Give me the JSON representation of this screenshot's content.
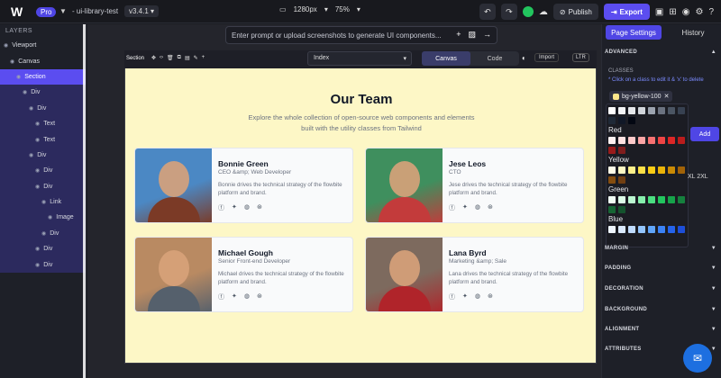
{
  "topbar": {
    "logo": "W",
    "plan_badge": "Pro",
    "project": "- ui-library-test",
    "version": "v3.4.1",
    "resolution": "1280px",
    "zoom": "75%",
    "publish_label": "Publish",
    "export_label": "Export"
  },
  "layers": {
    "title": "LAYERS",
    "items": [
      {
        "label": "Viewport",
        "indent": 0
      },
      {
        "label": "Canvas",
        "indent": 1
      },
      {
        "label": "Section",
        "indent": 2,
        "state": "selected"
      },
      {
        "label": "Div",
        "indent": 3,
        "state": "sub"
      },
      {
        "label": "Div",
        "indent": 4,
        "state": "sub"
      },
      {
        "label": "Text",
        "indent": 5,
        "state": "sub"
      },
      {
        "label": "Text",
        "indent": 5,
        "state": "sub"
      },
      {
        "label": "Div",
        "indent": 4,
        "state": "sub"
      },
      {
        "label": "Div",
        "indent": 5,
        "state": "sub"
      },
      {
        "label": "Div",
        "indent": 5,
        "state": "sub"
      },
      {
        "label": "Link",
        "indent": 6,
        "state": "sub"
      },
      {
        "label": "Image",
        "indent": 7,
        "state": "sub"
      },
      {
        "label": "Div",
        "indent": 6,
        "state": "sub"
      },
      {
        "label": "Div",
        "indent": 5,
        "state": "sub"
      },
      {
        "label": "Div",
        "indent": 5,
        "state": "sub"
      }
    ]
  },
  "prompt": {
    "placeholder": "Enter prompt or upload screenshots to generate UI components..."
  },
  "canvas_toolbar": {
    "section_label": "Section",
    "page_select": "Index",
    "canvas_label": "Canvas",
    "code_label": "Code",
    "import_label": "Import",
    "ltr_label": "LTR"
  },
  "content": {
    "title": "Our Team",
    "subtitle": "Explore the whole collection of open-source web components and elements built with the utility classes from Tailwind",
    "members": [
      {
        "name": "Bonnie Green",
        "role": "CEO &amp; Web Developer",
        "desc": "Bonnie drives the technical strategy of the flowbite platform and brand.",
        "photo_bg": "#4b88c4",
        "photo_fg": "#7b3a26"
      },
      {
        "name": "Jese Leos",
        "role": "CTO",
        "desc": "Jese drives the technical strategy of the flowbite platform and brand.",
        "photo_bg": "#3f8f5e",
        "photo_fg": "#c33b3b"
      },
      {
        "name": "Michael Gough",
        "role": "Senior Front-end Developer",
        "desc": "Michael drives the technical strategy of the flowbite platform and brand.",
        "photo_bg": "#b98a62",
        "photo_fg": "#55606c"
      },
      {
        "name": "Lana Byrd",
        "role": "Marketing &amp; Sale",
        "desc": "Lana drives the technical strategy of the flowbite platform and brand.",
        "photo_bg": "#7d6a5e",
        "photo_fg": "#b0242a"
      }
    ],
    "social_icons": [
      "facebook-icon",
      "twitter-icon",
      "github-icon",
      "dribbble-icon"
    ]
  },
  "settings": {
    "tab_page_settings": "Page Settings",
    "tab_history": "History",
    "advanced": "ADVANCED",
    "classes_label": "CLASSES",
    "hint": "* Click on a class to edit it & 'x' to delete",
    "chip": "bg-yellow-100",
    "add_label": "Add",
    "size_labels": "XL   2XL",
    "sections": [
      "MARGIN",
      "PADDING",
      "DECORATION",
      "BACKGROUND",
      "ALIGNMENT",
      "ATTRIBUTES"
    ],
    "palette": [
      {
        "name": "",
        "colors": [
          "#ffffff",
          "#f3f4f6",
          "#e5e7eb",
          "#d1d5db",
          "#9ca3af",
          "#6b7280",
          "#4b5563",
          "#374151"
        ]
      },
      {
        "name": "",
        "colors": [
          "#1f2937",
          "#111827",
          "#030712"
        ]
      },
      {
        "name": "Red",
        "colors": [
          "#fef2f2",
          "#fee2e2",
          "#fecaca",
          "#fca5a5",
          "#f87171",
          "#ef4444",
          "#dc2626",
          "#b91c1c"
        ]
      },
      {
        "name": "",
        "colors": [
          "#991b1b",
          "#7f1d1d"
        ]
      },
      {
        "name": "Yellow",
        "colors": [
          "#fefce8",
          "#fef9c3",
          "#fef08a",
          "#fde047",
          "#facc15",
          "#eab308",
          "#ca8a04",
          "#a16207"
        ]
      },
      {
        "name": "",
        "colors": [
          "#854d0e",
          "#713f12"
        ]
      },
      {
        "name": "Green",
        "colors": [
          "#f0fdf4",
          "#dcfce7",
          "#bbf7d0",
          "#86efac",
          "#4ade80",
          "#22c55e",
          "#16a34a",
          "#15803d"
        ]
      },
      {
        "name": "",
        "colors": [
          "#166534",
          "#14532d"
        ]
      },
      {
        "name": "Blue",
        "colors": [
          "#eff6ff",
          "#dbeafe",
          "#bfdbfe",
          "#93c5fd",
          "#60a5fa",
          "#3b82f6",
          "#2563eb",
          "#1d4ed8"
        ]
      }
    ]
  },
  "colors": {
    "accent": "#5b4df0",
    "canvas_bg": "#fdf7c6"
  }
}
